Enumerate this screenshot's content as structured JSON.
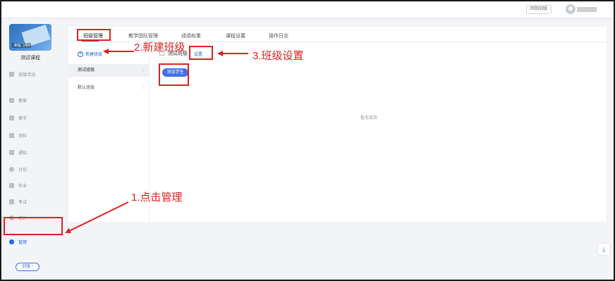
{
  "topbar": {
    "back_label": "回到旧版"
  },
  "sidebar": {
    "cover_label": "课程门户 ›",
    "course_title": "测试课程",
    "items": [
      {
        "label": "班级活动"
      },
      {
        "label": "教案"
      },
      {
        "label": "章节"
      },
      {
        "label": "资料"
      },
      {
        "label": "通知"
      },
      {
        "label": "讨论"
      },
      {
        "label": "作业"
      },
      {
        "label": "考试"
      },
      {
        "label": "统计"
      },
      {
        "label": "管理"
      }
    ],
    "old_version_label": "旧版 ›"
  },
  "tabs": [
    "班级管理",
    "教学团队管理",
    "成绩权重",
    "课程设置",
    "操作日志"
  ],
  "classes": {
    "new_label": "新建班级",
    "list": [
      "测试班级",
      "默认班级"
    ],
    "current": "测试班级",
    "settings_label": "设置",
    "add_student_label": "添加学生",
    "empty_text": "暂无成员"
  },
  "annotations": {
    "step1": "1.点击管理",
    "step2": "2.新建班级",
    "step3": "3.班级设置"
  },
  "colors": {
    "accent": "#2b66e0",
    "annotation": "#e02020"
  }
}
